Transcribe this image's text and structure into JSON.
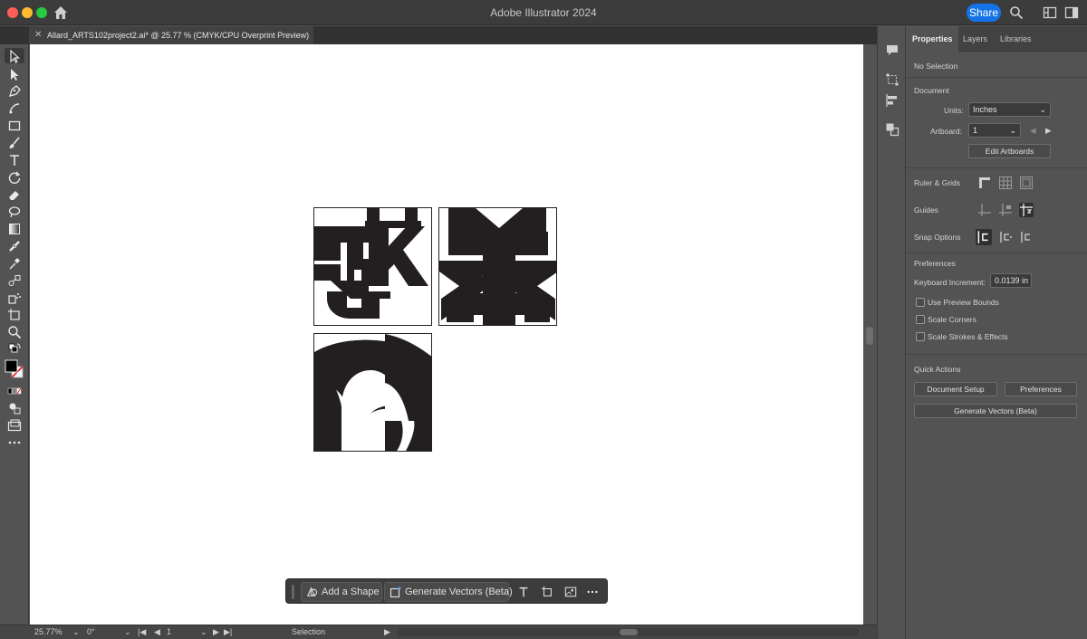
{
  "window": {
    "title": "Adobe Illustrator 2024",
    "share_label": "Share"
  },
  "document_tab": {
    "label": "Allard_ARTS102project2.ai* @ 25.77 % (CMYK/CPU Overprint Preview)"
  },
  "context_bar": {
    "add_shape_label": "Add a Shape",
    "generate_vectors_label": "Generate Vectors (Beta)"
  },
  "status_bar": {
    "zoom": "25.77%",
    "rotation": "0°",
    "artboard": "1",
    "tool": "Selection"
  },
  "panel": {
    "tabs": [
      "Properties",
      "Layers",
      "Libraries"
    ],
    "selection": "No Selection",
    "document_heading": "Document",
    "units_label": "Units:",
    "units_value": "Inches",
    "artboard_label": "Artboard:",
    "artboard_value": "1",
    "edit_artboards": "Edit Artboards",
    "ruler_grids": "Ruler & Grids",
    "guides": "Guides",
    "snap_options": "Snap Options",
    "preferences_heading": "Preferences",
    "keyboard_increment_label": "Keyboard Increment:",
    "keyboard_increment_value": "0.0139 in",
    "use_preview_bounds": "Use Preview Bounds",
    "scale_corners": "Scale Corners",
    "scale_strokes": "Scale Strokes & Effects",
    "quick_actions": "Quick Actions",
    "document_setup": "Document Setup",
    "preferences_btn": "Preferences",
    "generate_vectors": "Generate Vectors (Beta)"
  },
  "icons": {
    "home": "home-icon",
    "search": "search-icon",
    "workspace": "workspace-icon",
    "comments": "comments-icon",
    "transform": "transform-icon",
    "align": "align-icon",
    "pathfinder": "pathfinder-icon"
  },
  "colors": {
    "accent": "#1473e6",
    "panel_bg": "#535353",
    "canvas": "#ffffff",
    "ink": "#231f20"
  }
}
